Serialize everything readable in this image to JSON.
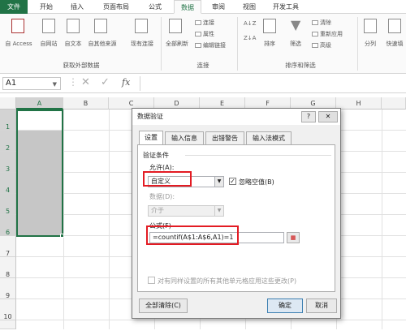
{
  "ribbon_tabs": [
    "文件",
    "开始",
    "插入",
    "页面布局",
    "公式",
    "数据",
    "审阅",
    "视图",
    "开发工具"
  ],
  "active_tab": "数据",
  "ribbon": {
    "get_external": {
      "buttons": [
        "自 Access",
        "自网站",
        "自文本",
        "自其他来源",
        "现有连接"
      ],
      "group_label": "获取外部数据"
    },
    "connections": {
      "refresh_all": "全部刷新",
      "items": [
        "连接",
        "属性",
        "编辑链接"
      ],
      "group_label": "连接"
    },
    "sort_filter": {
      "sort": "排序",
      "filter": "筛选",
      "items": [
        "清除",
        "重新应用",
        "高级"
      ],
      "group_label": "排序和筛选"
    },
    "tools": [
      "分列",
      "快速填"
    ]
  },
  "formula_bar": {
    "name_box": "A1",
    "cancel_icon": "✕",
    "enter_icon": "✓",
    "fx_icon": "fx"
  },
  "columns": [
    "A",
    "B",
    "C",
    "D",
    "E",
    "F",
    "G",
    "H"
  ],
  "rows": [
    "1",
    "2",
    "3",
    "4",
    "5",
    "6",
    "7",
    "8",
    "9",
    "10"
  ],
  "dialog": {
    "title": "数据验证",
    "help_btn": "?",
    "close_btn": "✕",
    "tabs": [
      "设置",
      "输入信息",
      "出错警告",
      "输入法模式"
    ],
    "section_label": "验证条件",
    "allow_label": "允许(A):",
    "allow_value": "自定义",
    "ignore_blank_label": "忽略空值(B)",
    "data_label": "数据(D):",
    "data_value": "介于",
    "formula_label": "公式(F)",
    "formula_value": "=countif(A$1:A$6,A1)=1",
    "apply_all_label": "对有同样设置的所有其他单元格应用这些更改(P)",
    "clear_all": "全部清除(C)",
    "ok": "确定",
    "cancel": "取消"
  },
  "highlight_color": "#e31b23",
  "accent_color": "#217346"
}
